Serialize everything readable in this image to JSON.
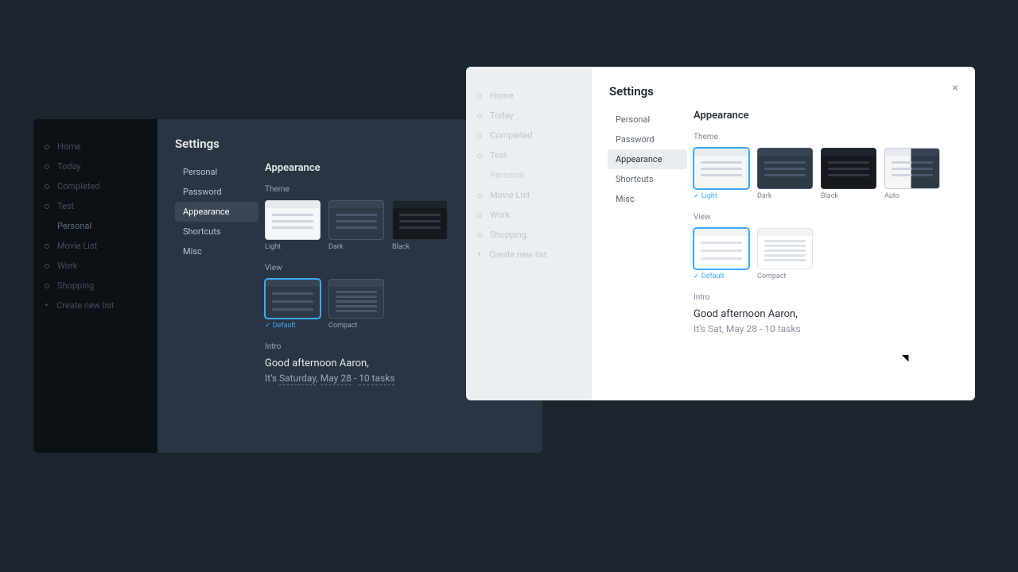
{
  "app_nav": {
    "items": [
      {
        "label": "Home"
      },
      {
        "label": "Today"
      },
      {
        "label": "Completed"
      },
      {
        "label": "Test"
      },
      {
        "label": "Personal",
        "sub": true
      },
      {
        "label": "Movie List"
      },
      {
        "label": "Work"
      },
      {
        "label": "Shopping"
      },
      {
        "label": "Create new list"
      }
    ]
  },
  "modal": {
    "title": "Settings",
    "nav": [
      {
        "label": "Personal"
      },
      {
        "label": "Password"
      },
      {
        "label": "Appearance",
        "active": true
      },
      {
        "label": "Shortcuts"
      },
      {
        "label": "Misc"
      }
    ]
  },
  "dark": {
    "content_title": "Appearance",
    "theme_label": "Theme",
    "themes": [
      {
        "label": "Light",
        "selected": false,
        "kind": "light"
      },
      {
        "label": "Dark",
        "selected": false,
        "kind": "dark"
      },
      {
        "label": "Black",
        "selected": false,
        "kind": "black"
      }
    ],
    "view_label": "View",
    "views": [
      {
        "label": "Default",
        "selected": true,
        "kind": "dark"
      },
      {
        "label": "Compact",
        "selected": false,
        "kind": "dark"
      }
    ],
    "intro_label": "Intro",
    "intro_greeting": "Good afternoon Aaron,",
    "intro_sub_prefix": "It's ",
    "intro_sub_day": "Saturday",
    "intro_sub_sep1": ", ",
    "intro_sub_date": "May 28",
    "intro_sub_sep2": " - ",
    "intro_sub_tasks": "10 tasks"
  },
  "light": {
    "content_title": "Appearance",
    "theme_label": "Theme",
    "themes": [
      {
        "label": "Light",
        "selected": true,
        "kind": "light"
      },
      {
        "label": "Dark",
        "selected": false,
        "kind": "dark"
      },
      {
        "label": "Black",
        "selected": false,
        "kind": "black"
      },
      {
        "label": "Auto",
        "selected": false,
        "kind": "auto"
      }
    ],
    "view_label": "View",
    "views": [
      {
        "label": "Default",
        "selected": true,
        "kind": "default-light"
      },
      {
        "label": "Compact",
        "selected": false,
        "kind": "compact-light"
      }
    ],
    "intro_label": "Intro",
    "intro_greeting": "Good afternoon Aaron,",
    "intro_sub": "It's Sat, May 28 - 10 tasks"
  }
}
